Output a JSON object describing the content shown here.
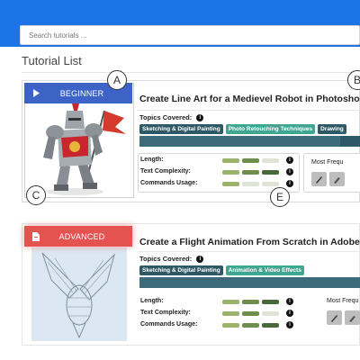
{
  "search": {
    "placeholder": "Search tutorials ..."
  },
  "page": {
    "title": "Tutorial List"
  },
  "callouts": [
    "A",
    "B",
    "C",
    "E",
    "E"
  ],
  "labels": {
    "topics_covered": "Topics Covered:",
    "length": "Length:",
    "text_complexity": "Text Complexity:",
    "commands_usage": "Commands Usage:",
    "most_frequent": "Most Frequ"
  },
  "cards": [
    {
      "level": "BEGINNER",
      "level_icon": "play-icon",
      "level_color": "#3d63c7",
      "title": "Create Line Art for a Medievel Robot in Photoshop",
      "tags": [
        "Sketching & Digital Painting",
        "Photo Retouching Techniques",
        "Drawing"
      ],
      "topic_progress": 0.9,
      "metrics": {
        "length": 2,
        "text_complexity": 3,
        "commands_usage": 1
      },
      "tool_icons": [
        "pen-tool-icon",
        "brush-tool-icon"
      ]
    },
    {
      "level": "ADVANCED",
      "level_icon": "document-icon",
      "level_color": "#e55351",
      "title": "Create a Flight Animation From Scratch in Adobe",
      "tags": [
        "Sketching & Digital Painting",
        "Animation & Video Effects"
      ],
      "topic_progress": 1.0,
      "metrics": {
        "length": 3,
        "text_complexity": 2,
        "commands_usage": 3
      },
      "tool_icons": [
        "pen-tool-icon",
        "brush-tool-icon"
      ]
    }
  ],
  "colors": {
    "header": "#1d74e6",
    "tag_dark": "#2f5866",
    "tag_teal": "#3fa691",
    "metric_levels": [
      "#9bb36a",
      "#6f8e4d",
      "#48693a"
    ]
  }
}
